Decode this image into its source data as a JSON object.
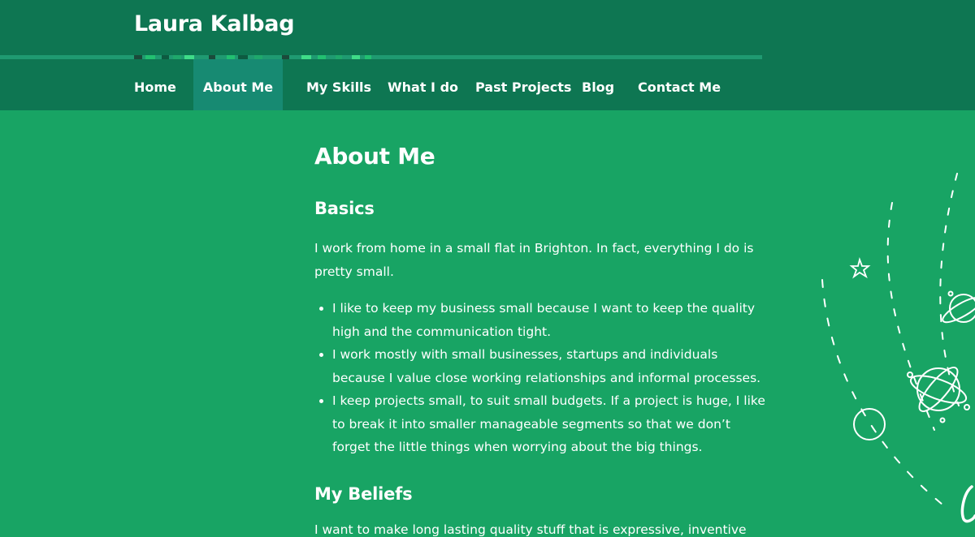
{
  "header": {
    "site_title": "Laura Kalbag"
  },
  "nav": {
    "items": [
      {
        "label": "Home"
      },
      {
        "label": "About Me"
      },
      {
        "label": "My Skills"
      },
      {
        "label": "What I do"
      },
      {
        "label": "Past Projects"
      },
      {
        "label": "Blog"
      },
      {
        "label": "Contact Me"
      }
    ],
    "active_item": "About Me"
  },
  "main": {
    "title": "About Me",
    "sections": [
      {
        "heading": "Basics",
        "paragraph": "I work from home in a small flat in Brighton. In fact, everything I do is pretty small.",
        "bullets": [
          "I like to keep my business small because I want to keep the quality high and the communication tight.",
          "I work mostly with small businesses, startups and individuals because I value close working relationships and informal processes.",
          "I keep projects small, to suit small budgets. If a project is huge, I like to break it into smaller manageable segments so that we don’t forget the little things when worrying about the big things."
        ]
      },
      {
        "heading": "My Beliefs",
        "cutoff_text": "I want to make long lasting quality stuff that is expressive, inventive"
      }
    ]
  },
  "colors": {
    "page_background": "#18a464",
    "header_background": "#0e7652",
    "active_nav_background": "#178a72",
    "text": "#ffffff"
  },
  "decoration": {
    "icon": "space-doodle-illustration"
  }
}
